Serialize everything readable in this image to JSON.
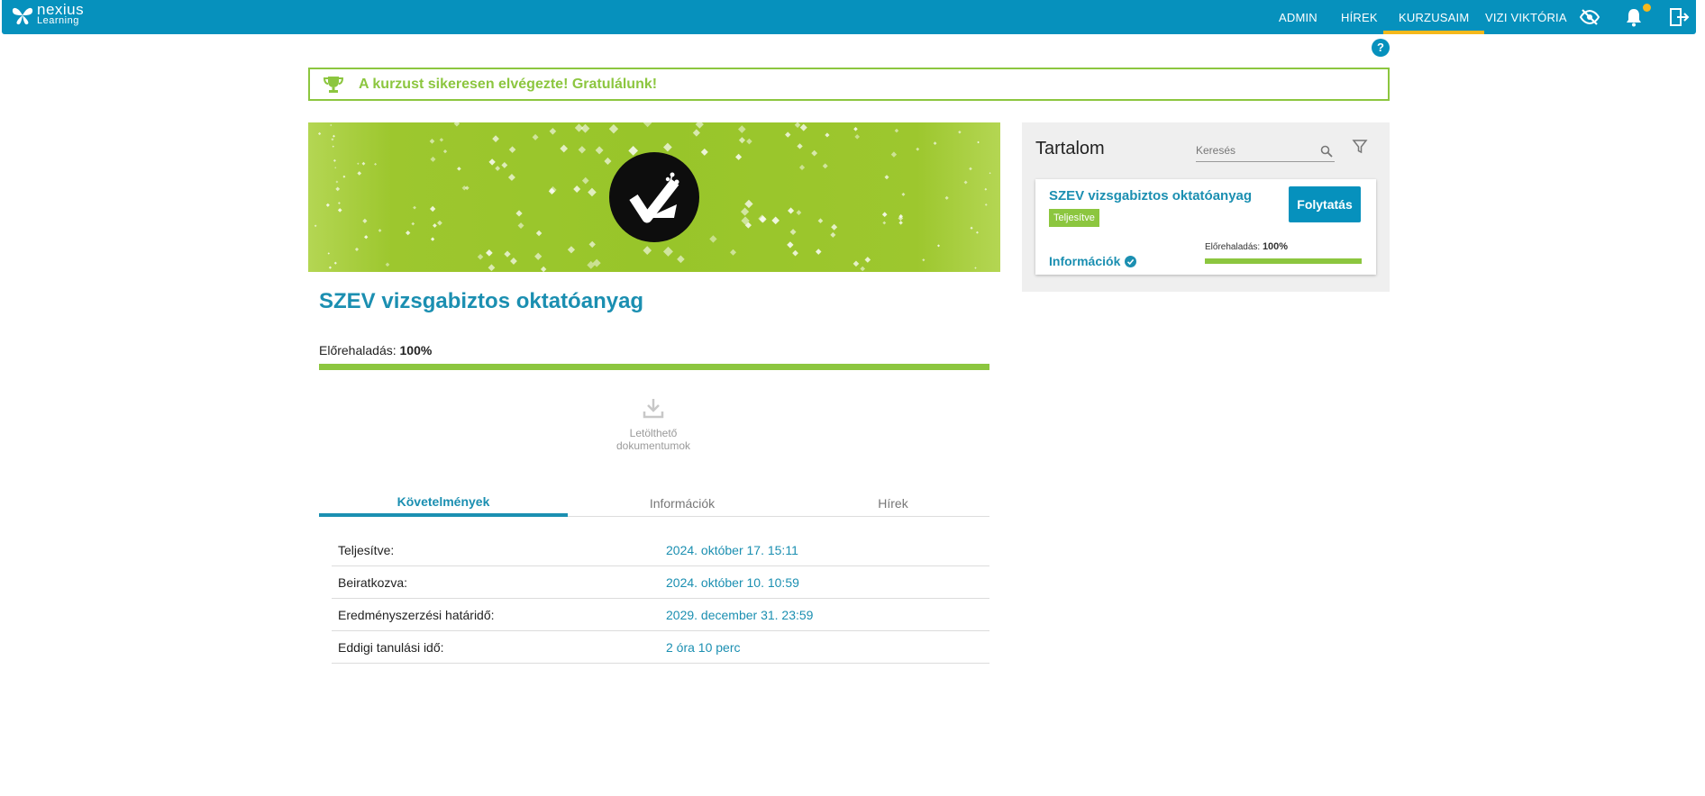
{
  "app": {
    "logo_line1": "nexius",
    "logo_line2": "Learning",
    "nav": {
      "admin": "ADMIN",
      "news": "HÍREK",
      "courses": "KURZUSAIM",
      "user": "VIZI VIKTÓRIA"
    },
    "icons": [
      "hide-icon",
      "bell-icon",
      "logout-icon"
    ],
    "help_label": "?"
  },
  "banner": {
    "icon": "trophy-icon",
    "message": "A kurzust sikeresen elvégezte! Gratulálunk!"
  },
  "course": {
    "title": "SZEV vizsgabiztos oktatóanyag",
    "progress_label": "Előrehaladás:",
    "progress_value": "100%",
    "progress_fraction": 1.0,
    "download": {
      "line1": "Letölthető",
      "line2": "dokumentumok"
    },
    "tabs": [
      {
        "label": "Követelmények",
        "active": true
      },
      {
        "label": "Információk",
        "active": false
      },
      {
        "label": "Hírek",
        "active": false
      }
    ],
    "requirements": [
      {
        "key": "Teljesítve:",
        "value": "2024. október 17. 15:11"
      },
      {
        "key": "Beiratkozva:",
        "value": "2024. október 10. 10:59"
      },
      {
        "key": "Eredményszerzési határidő:",
        "value": "2029. december 31. 23:59"
      },
      {
        "key": "Eddigi tanulási idő:",
        "value": "2 óra 10 perc"
      }
    ]
  },
  "panel": {
    "title": "Tartalom",
    "search_placeholder": "Keresés",
    "card": {
      "title": "SZEV vizsgabiztos oktatóanyag",
      "badge": "Teljesítve",
      "button": "Folytatás",
      "info": "Információk",
      "progress_label": "Előrehaladás:",
      "progress_value": "100%",
      "progress_fraction": 1.0
    }
  },
  "colors": {
    "primary": "#0691bd",
    "accent": "#8cc63f",
    "link": "#1b8fb1",
    "highlight": "#f5b81c"
  }
}
